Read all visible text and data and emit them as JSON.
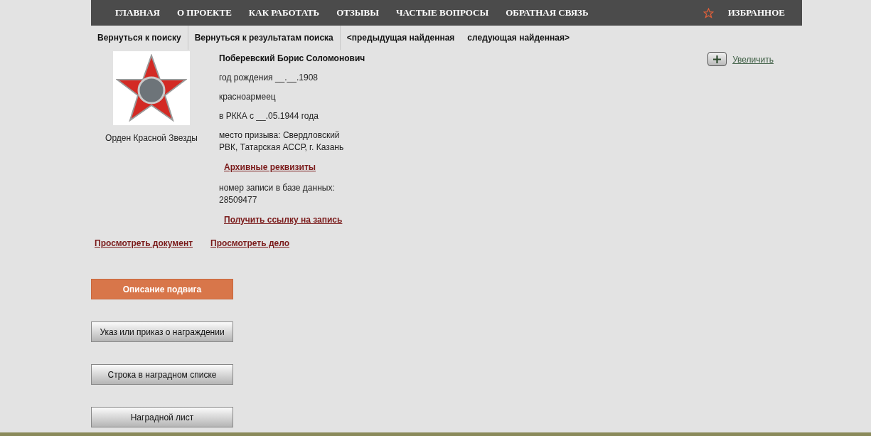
{
  "nav": {
    "items": [
      "ГЛАВНАЯ",
      "О ПРОЕКТЕ",
      "КАК РАБОТАТЬ",
      "ОТЗЫВЫ",
      "ЧАСТЫЕ ВОПРОСЫ",
      "ОБРАТНАЯ СВЯЗЬ"
    ],
    "favorites": "ИЗБРАННОЕ"
  },
  "subnav": [
    {
      "label": "Вернуться к поиску",
      "divider": true
    },
    {
      "label": "Вернуться к результатам поиска",
      "divider": true
    },
    {
      "label": "<предыдущая найденная",
      "divider": false
    },
    {
      "label": "следующая найденная>",
      "divider": false
    }
  ],
  "award": {
    "caption": "Орден Красной Звезды"
  },
  "person": {
    "name": "Поберевский Борис Соломонович",
    "rows": [
      {
        "kind": "text",
        "text": "год рождения __.__.1908"
      },
      {
        "kind": "text",
        "text": "красноармеец"
      },
      {
        "kind": "text",
        "text": "в РККА с __.05.1944 года"
      },
      {
        "kind": "text",
        "text": "место призыва: Свердловский РВК, Татарская АССР, г. Казань"
      },
      {
        "kind": "link",
        "text": "Архивные реквизиты"
      },
      {
        "kind": "text",
        "text": "номер записи в базе данных: 28509477"
      },
      {
        "kind": "link",
        "text": "Получить ссылку на запись"
      }
    ]
  },
  "zoom": {
    "label": "Увеличить"
  },
  "doc_links": [
    "Просмотреть документ",
    "Просмотреть дело"
  ],
  "sections": [
    {
      "label": "Описание подвига",
      "selected": true
    },
    {
      "label": "Указ или приказ о награждении",
      "selected": false
    },
    {
      "label": "Строка в наградном списке",
      "selected": false
    },
    {
      "label": "Наградной лист",
      "selected": false
    }
  ]
}
